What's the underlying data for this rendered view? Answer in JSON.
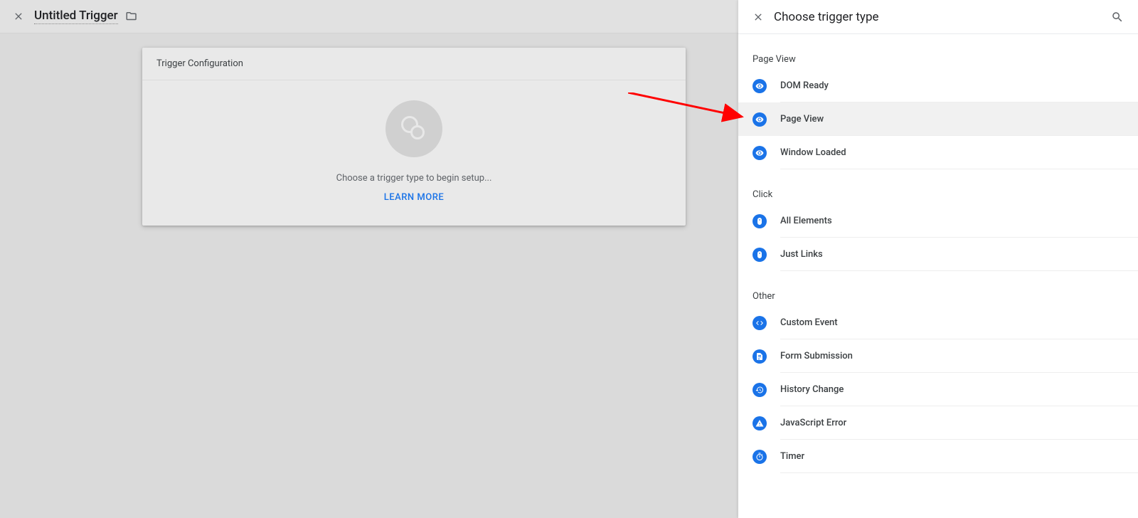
{
  "main": {
    "title": "Untitled Trigger",
    "card": {
      "header": "Trigger Configuration",
      "placeholder_text": "Choose a trigger type to begin setup...",
      "learn_more": "LEARN MORE"
    }
  },
  "panel": {
    "title": "Choose trigger type",
    "sections": [
      {
        "header": "Page View",
        "items": [
          {
            "label": "DOM Ready",
            "icon": "eye",
            "highlighted": false
          },
          {
            "label": "Page View",
            "icon": "eye",
            "highlighted": true
          },
          {
            "label": "Window Loaded",
            "icon": "eye",
            "highlighted": false
          }
        ]
      },
      {
        "header": "Click",
        "items": [
          {
            "label": "All Elements",
            "icon": "mouse",
            "highlighted": false
          },
          {
            "label": "Just Links",
            "icon": "mouse",
            "highlighted": false
          }
        ]
      },
      {
        "header": "Other",
        "items": [
          {
            "label": "Custom Event",
            "icon": "code",
            "highlighted": false
          },
          {
            "label": "Form Submission",
            "icon": "form",
            "highlighted": false
          },
          {
            "label": "History Change",
            "icon": "history",
            "highlighted": false
          },
          {
            "label": "JavaScript Error",
            "icon": "error",
            "highlighted": false
          },
          {
            "label": "Timer",
            "icon": "timer",
            "highlighted": false
          }
        ]
      }
    ]
  }
}
